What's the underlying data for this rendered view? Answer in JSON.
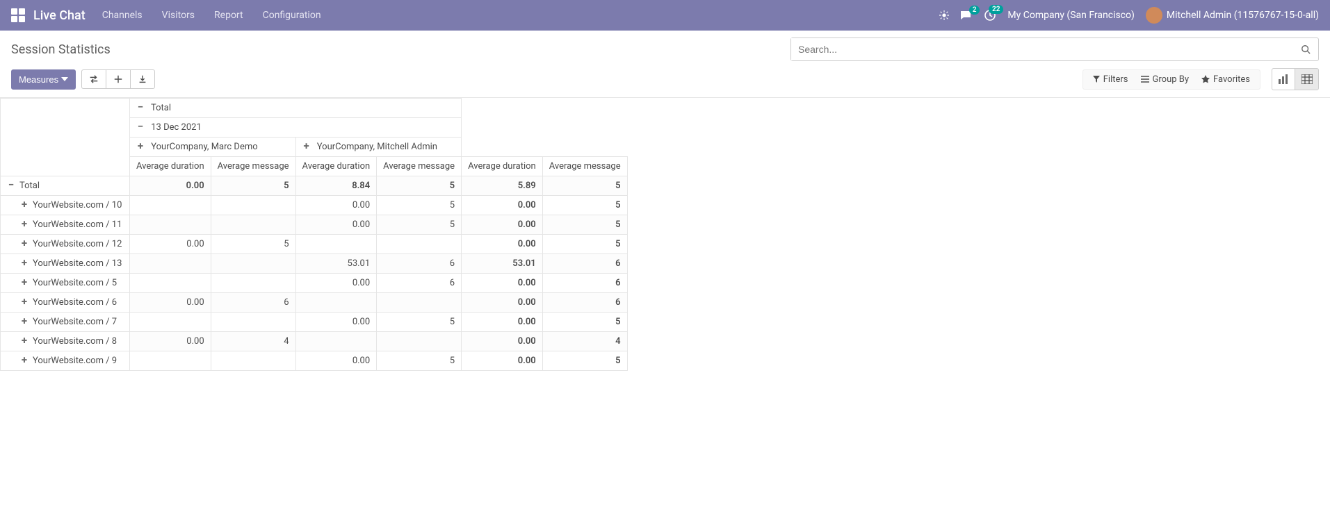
{
  "nav": {
    "brand": "Live Chat",
    "links": [
      "Channels",
      "Visitors",
      "Report",
      "Configuration"
    ],
    "messages_badge": "2",
    "activities_badge": "22",
    "company": "My Company (San Francisco)",
    "user": "Mitchell Admin (11576767-15-0-all)"
  },
  "cp": {
    "title": "Session Statistics",
    "search_placeholder": "Search...",
    "measures_btn": "Measures",
    "filters": "Filters",
    "group_by": "Group By",
    "favorites": "Favorites"
  },
  "pivot": {
    "col_headers": {
      "top": "Total",
      "date": "13 Dec 2021",
      "g1": "YourCompany, Marc Demo",
      "g2": "YourCompany, Mitchell Admin"
    },
    "measures": {
      "m1": "Average duration",
      "m2": "Average message"
    },
    "row_total_label": "Total",
    "rows": [
      {
        "label": "Total",
        "indent": 0,
        "toggle": "−",
        "bold": true,
        "c": [
          "0.00",
          "5",
          "8.84",
          "5",
          "5.89",
          "5"
        ],
        "boldcols": [
          0,
          1,
          2,
          3,
          4,
          5
        ]
      },
      {
        "label": "YourWebsite.com / 10",
        "indent": 1,
        "toggle": "+",
        "c": [
          "",
          "",
          "0.00",
          "5",
          "0.00",
          "5"
        ],
        "boldcols": [
          4,
          5
        ]
      },
      {
        "label": "YourWebsite.com / 11",
        "indent": 1,
        "toggle": "+",
        "c": [
          "",
          "",
          "0.00",
          "5",
          "0.00",
          "5"
        ],
        "boldcols": [
          4,
          5
        ]
      },
      {
        "label": "YourWebsite.com / 12",
        "indent": 1,
        "toggle": "+",
        "c": [
          "0.00",
          "5",
          "",
          "",
          "0.00",
          "5"
        ],
        "boldcols": [
          4,
          5
        ]
      },
      {
        "label": "YourWebsite.com / 13",
        "indent": 1,
        "toggle": "+",
        "c": [
          "",
          "",
          "53.01",
          "6",
          "53.01",
          "6"
        ],
        "boldcols": [
          4,
          5
        ]
      },
      {
        "label": "YourWebsite.com / 5",
        "indent": 1,
        "toggle": "+",
        "c": [
          "",
          "",
          "0.00",
          "6",
          "0.00",
          "6"
        ],
        "boldcols": [
          4,
          5
        ]
      },
      {
        "label": "YourWebsite.com / 6",
        "indent": 1,
        "toggle": "+",
        "c": [
          "0.00",
          "6",
          "",
          "",
          "0.00",
          "6"
        ],
        "boldcols": [
          4,
          5
        ]
      },
      {
        "label": "YourWebsite.com / 7",
        "indent": 1,
        "toggle": "+",
        "c": [
          "",
          "",
          "0.00",
          "5",
          "0.00",
          "5"
        ],
        "boldcols": [
          4,
          5
        ]
      },
      {
        "label": "YourWebsite.com / 8",
        "indent": 1,
        "toggle": "+",
        "c": [
          "0.00",
          "4",
          "",
          "",
          "0.00",
          "4"
        ],
        "boldcols": [
          4,
          5
        ]
      },
      {
        "label": "YourWebsite.com / 9",
        "indent": 1,
        "toggle": "+",
        "c": [
          "",
          "",
          "0.00",
          "5",
          "0.00",
          "5"
        ],
        "boldcols": [
          4,
          5
        ]
      }
    ]
  }
}
